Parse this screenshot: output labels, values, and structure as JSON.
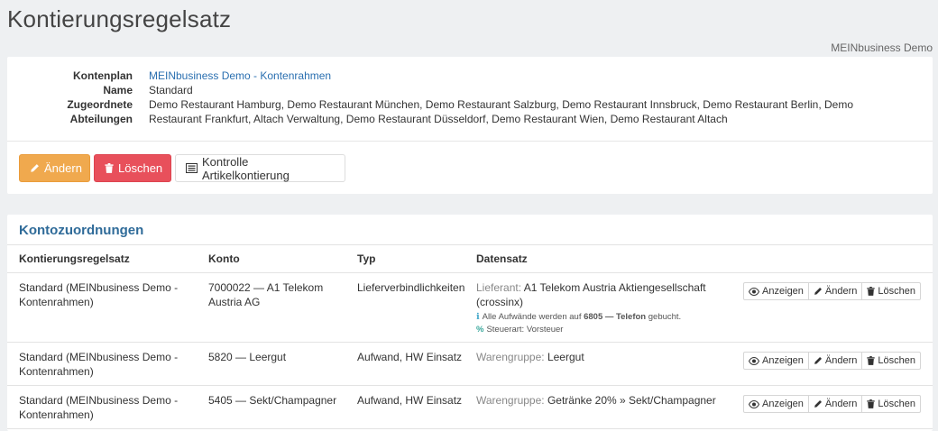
{
  "header": {
    "title": "Kontierungsregelsatz",
    "company": "MEINbusiness Demo"
  },
  "details": {
    "kontenplan_label": "Kontenplan",
    "kontenplan_value": "MEINbusiness Demo - Kontenrahmen",
    "name_label": "Name",
    "name_value": "Standard",
    "abteilungen_label": "Zugeordnete Abteilungen",
    "abteilungen_value": "Demo Restaurant Hamburg, Demo Restaurant München, Demo Restaurant Salzburg, Demo Restaurant Innsbruck, Demo Restaurant Berlin, Demo Restaurant Frankfurt, Altach Verwaltung, Demo Restaurant Düsseldorf, Demo Restaurant Wien, Demo Restaurant Altach"
  },
  "toolbar": {
    "edit_label": "Ändern",
    "delete_label": "Löschen",
    "check_label": "Kontrolle Artikelkontierung"
  },
  "table": {
    "title": "Kontozuordnungen",
    "columns": [
      "Kontierungsregelsatz",
      "Konto",
      "Typ",
      "Datensatz"
    ],
    "actions": {
      "view": "Anzeigen",
      "edit": "Ändern",
      "delete": "Löschen"
    },
    "rows": [
      {
        "regelsatz": "Standard (MEINbusiness Demo - Kontenrahmen)",
        "konto": "7000022 — A1 Telekom Austria AG",
        "typ": "Lieferverbindlichkeiten",
        "datensatz_prefix": "Lieferant:",
        "datensatz_value": "A1 Telekom Austria Aktiengesellschaft (crossinx)",
        "note_info_prefix": "Alle Aufwände werden auf",
        "note_info_account": "6805 — Telefon",
        "note_info_suffix": "gebucht.",
        "note_tax_label": "Steuerart:",
        "note_tax_value": "Vorsteuer"
      },
      {
        "regelsatz": "Standard (MEINbusiness Demo - Kontenrahmen)",
        "konto": "5820 — Leergut",
        "typ": "Aufwand, HW Einsatz",
        "datensatz_prefix": "Warengruppe:",
        "datensatz_value": "Leergut"
      },
      {
        "regelsatz": "Standard (MEINbusiness Demo - Kontenrahmen)",
        "konto": "5405 — Sekt/Champagner",
        "typ": "Aufwand, HW Einsatz",
        "datensatz_prefix": "Warengruppe:",
        "datensatz_value": "Getränke 20% » Sekt/Champagner"
      }
    ]
  },
  "icons": {
    "edit": "pencil-icon",
    "delete": "trash-icon",
    "check": "list-icon",
    "view": "eye-icon",
    "info": "info-icon",
    "percent": "percent-icon"
  },
  "colors": {
    "warning": "#f0a94e",
    "danger": "#e8505b",
    "link": "#2a6fb0",
    "section_title": "#2f6b99"
  }
}
